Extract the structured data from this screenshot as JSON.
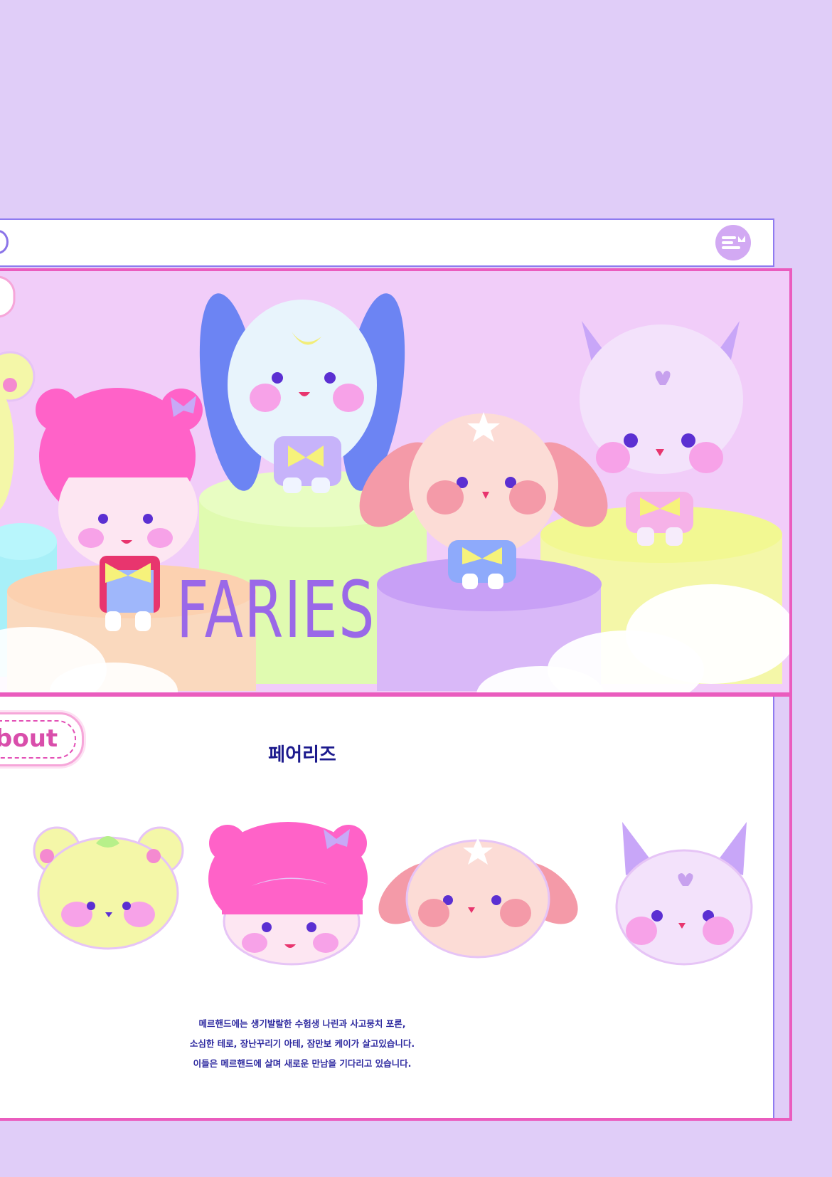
{
  "hero": {
    "title": "FARIES"
  },
  "about": {
    "badge": "bout",
    "title": "페어리즈",
    "lines": [
      "메르핸드에는 생기발랄한 수험생 나린과 사고뭉치 포론,",
      "소심한 테로, 장난꾸리기 아테, 잠만보 케이가 살고있습니다.",
      "이들은 메르핸드에 살며 새로운 만남을 기다리고 있습니다."
    ]
  },
  "icons": {
    "menu": "menu-icon",
    "logo": "logo-icon"
  },
  "colors": {
    "background": "#e0cdf8",
    "accent_pink": "#ea5cbe",
    "accent_purple": "#8e7bf0",
    "text_navy": "#1c1a8d"
  }
}
